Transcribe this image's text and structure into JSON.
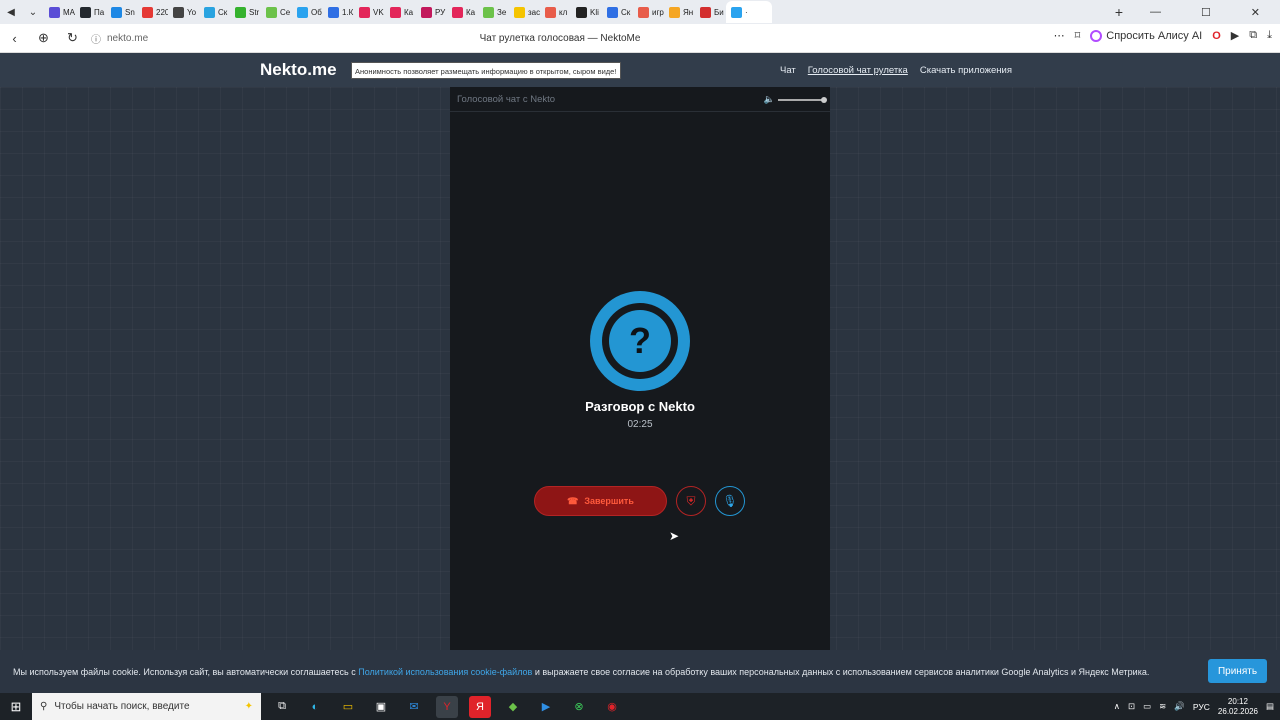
{
  "browser": {
    "tabs": [
      {
        "label": "МА",
        "color": "#5a4dd6"
      },
      {
        "label": "Па",
        "color": "#24292f"
      },
      {
        "label": "Sn",
        "color": "#1e88e5"
      },
      {
        "label": "220",
        "color": "#e53935"
      },
      {
        "label": "Yo",
        "color": "#444444"
      },
      {
        "label": "Ск",
        "color": "#29a3e0"
      },
      {
        "label": "Str",
        "color": "#35b22e"
      },
      {
        "label": "Се",
        "color": "#6cc24a"
      },
      {
        "label": "Об",
        "color": "#2aa3ef"
      },
      {
        "label": "1.К",
        "color": "#2f6fe4"
      },
      {
        "label": "VK",
        "color": "#e3265a"
      },
      {
        "label": "Ка",
        "color": "#e3265a"
      },
      {
        "label": "РУ",
        "color": "#c2185b"
      },
      {
        "label": "Ка",
        "color": "#e3265a"
      },
      {
        "label": "Зе",
        "color": "#6cc24a"
      },
      {
        "label": "зас",
        "color": "#f5c400"
      },
      {
        "label": "кл",
        "color": "#e85c4a"
      },
      {
        "label": "Kli",
        "color": "#222222"
      },
      {
        "label": "Ск",
        "color": "#2f6fe4"
      },
      {
        "label": "игр",
        "color": "#e85c4a"
      },
      {
        "label": "Ян",
        "color": "#f5a623"
      },
      {
        "label": "Би",
        "color": "#d32f2f"
      },
      {
        "label": "·",
        "color": "#2aa3ef",
        "active": true
      }
    ],
    "url": "nekto.me",
    "page_title": "Чат рулетка голосовая — NektoMe",
    "alisa_label": "Спросить Алису AI"
  },
  "header": {
    "logo": "Nekto.me",
    "notice": "Анонимность позволяет размещать информацию в открытом, сыром виде!",
    "nav": [
      "Чат",
      "Голосовой чат рулетка",
      "Скачать приложения"
    ]
  },
  "panel": {
    "head_title": "Голосовой чат с Nekto",
    "avatar_symbol": "?",
    "conversation_title": "Разговор с Nekto",
    "timer": "02:25",
    "end_label": "Завершить"
  },
  "cookie": {
    "text_before": "Мы используем файлы cookie. Используя сайт, вы автоматически соглашаетесь с ",
    "link": "Политикой использования cookie-файлов",
    "text_after": " и выражаете свое согласие на обработку ваших персональных данных с использованием сервисов аналитики Google Analytics и Яндекс Метрика.",
    "accept": "Принять"
  },
  "taskbar": {
    "search_placeholder": "Чтобы начать поиск, введите",
    "lang": "РУС",
    "time": "20:12",
    "date": "26.02.2026"
  },
  "colors": {
    "accent": "#2396d3",
    "danger": "#8e1515",
    "header_bg": "#323d4b"
  }
}
